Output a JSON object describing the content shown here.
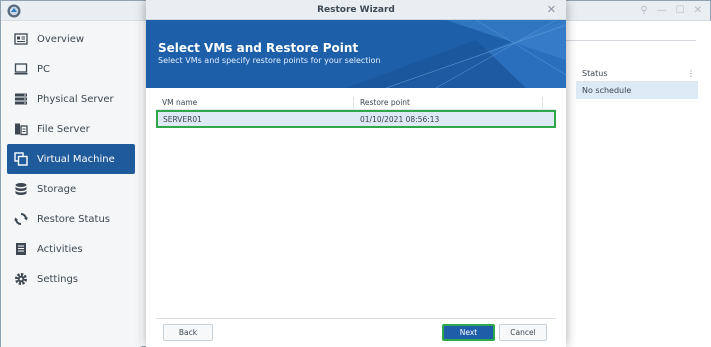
{
  "sidebar": {
    "items": [
      {
        "label": "Overview",
        "icon": "overview-icon"
      },
      {
        "label": "PC",
        "icon": "pc-icon"
      },
      {
        "label": "Physical Server",
        "icon": "physical-server-icon"
      },
      {
        "label": "File Server",
        "icon": "file-server-icon"
      },
      {
        "label": "Virtual Machine",
        "icon": "virtual-machine-icon",
        "active": true
      },
      {
        "label": "Storage",
        "icon": "storage-icon"
      },
      {
        "label": "Restore Status",
        "icon": "restore-status-icon"
      },
      {
        "label": "Activities",
        "icon": "activities-icon"
      },
      {
        "label": "Settings",
        "icon": "settings-icon"
      }
    ]
  },
  "right_panel": {
    "column_header": "Status",
    "column_menu_glyph": "⋮",
    "status_value": "No schedule"
  },
  "dialog": {
    "title": "Restore Wizard",
    "close_glyph": "✕",
    "banner_title": "Select VMs and Restore Point",
    "banner_subtitle": "Select VMs and specify restore points for your selection",
    "table": {
      "headers": {
        "vm_name": "VM name",
        "restore_point": "Restore point"
      },
      "rows": [
        {
          "vm_name": "SERVER01",
          "restore_point": "01/10/2021 08:56:13"
        }
      ]
    },
    "buttons": {
      "back": "Back",
      "next": "Next",
      "cancel": "Cancel"
    }
  },
  "window_controls": {
    "pin": "⚲",
    "minimize": "—",
    "maximize": "☐",
    "close": "✕"
  },
  "colors": {
    "accent": "#1f5a9b",
    "banner": "#1d5fa9",
    "selection": "#dde9f5",
    "highlight": "#2ea84a"
  }
}
